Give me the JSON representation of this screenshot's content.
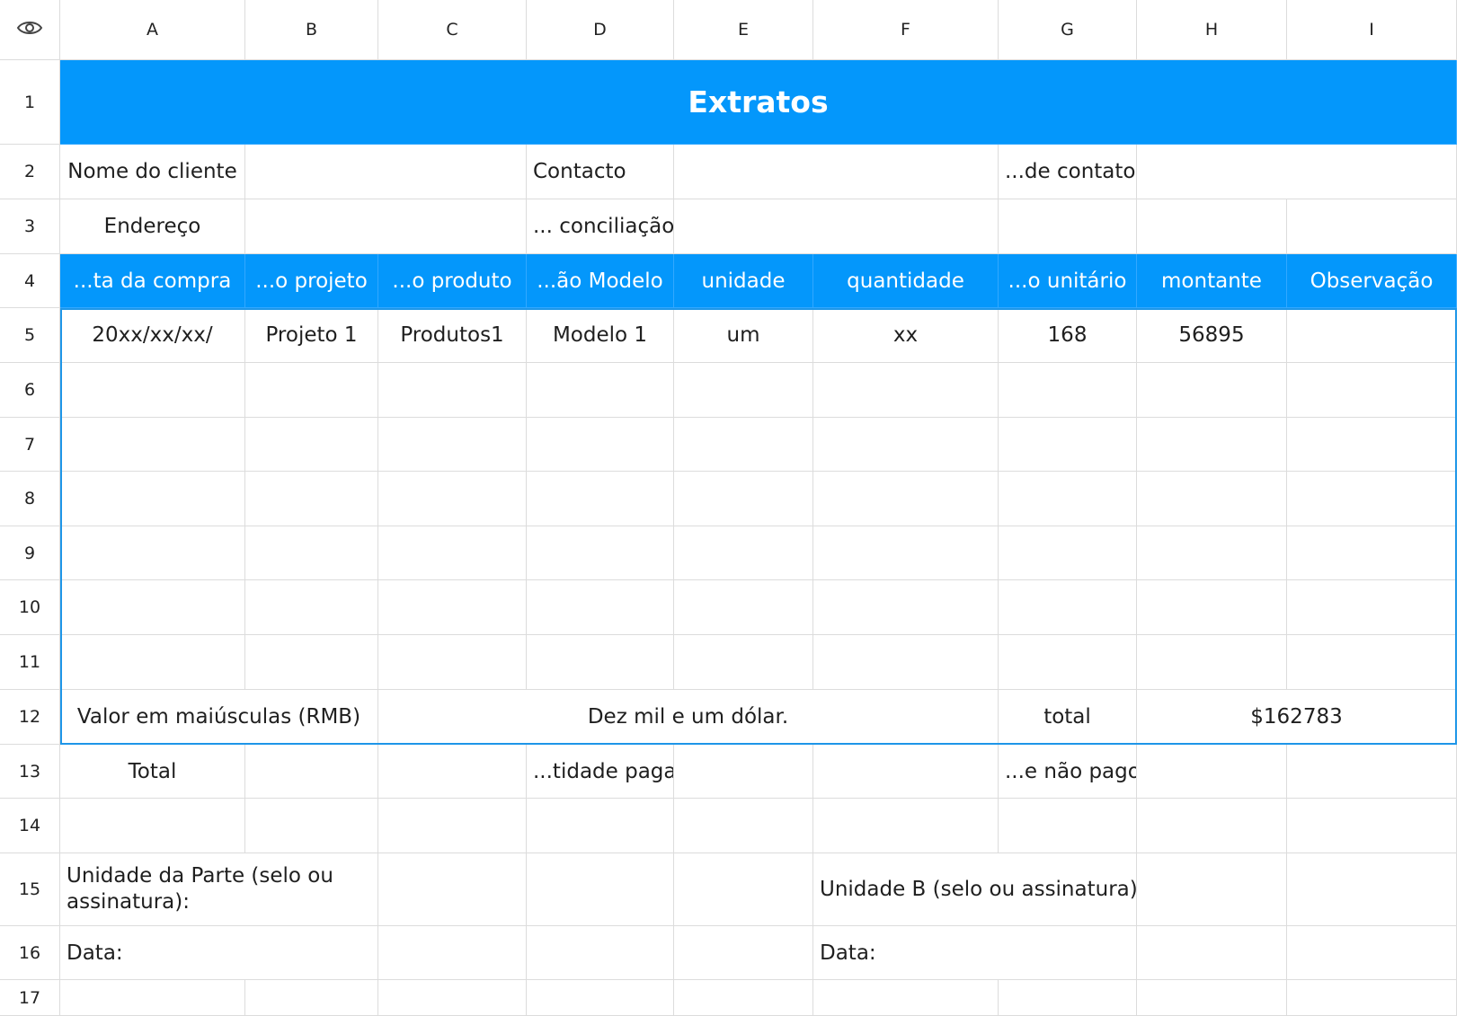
{
  "columns": [
    "A",
    "B",
    "C",
    "D",
    "E",
    "F",
    "G",
    "H",
    "I"
  ],
  "rows": [
    "1",
    "2",
    "3",
    "4",
    "5",
    "6",
    "7",
    "8",
    "9",
    "10",
    "11",
    "12",
    "13",
    "14",
    "15",
    "16",
    "17"
  ],
  "icons": {
    "visibility": "eye-icon"
  },
  "colors": {
    "header_blue": "#0497fb",
    "selection_border": "#1e96e8",
    "grid": "#dcdcdc"
  },
  "sheet": {
    "title": "Extratos",
    "r2": {
      "a": "Nome do cliente",
      "d": "Contacto",
      "g": "...de contato"
    },
    "r3": {
      "a": "Endereço",
      "d": "... conciliação"
    },
    "headers": [
      "...ta da compra",
      "...o projeto",
      "...o produto",
      "...ão Modelo",
      "unidade",
      "quantidade",
      "...o unitário",
      "montante",
      "Observação"
    ],
    "r5": [
      "20xx/xx/xx/",
      "Projeto 1",
      "Produtos1",
      "Modelo 1",
      "um",
      "xx",
      "168",
      "56895",
      ""
    ],
    "r12": {
      "label": "Valor em maiúsculas (RMB)",
      "words": "Dez mil e um dólar.",
      "total_label": "total",
      "total_value": "$162783"
    },
    "r13": {
      "a": "Total",
      "d": "...tidade paga",
      "g": "...e não pago"
    },
    "r15": {
      "a": "Unidade da Parte (selo ou assinatura):",
      "f": "Unidade B (selo ou assinatura):"
    },
    "r16": {
      "a": "Data:",
      "f": "Data:"
    }
  }
}
